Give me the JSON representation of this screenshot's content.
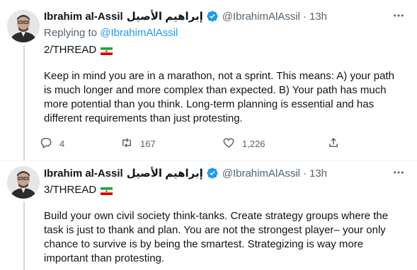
{
  "tweets": [
    {
      "author_name": "Ibrahim al-Assil",
      "author_name_arabic": "إبراهيم الأصيل",
      "handle": "@IbrahimAlAssil",
      "separator": "·",
      "time": "13h",
      "replying_prefix": "Replying to",
      "replying_handle": "@IbrahimAlAssil",
      "thread_label": "2/THREAD",
      "body": "Keep in mind you are in a marathon, not a sprint. This means: A) your path is much longer and more complex than expected. B) Your path has much more potential than you think. Long-term planning is essential and has different requirements than just protesting.",
      "reply_count": "4",
      "retweet_count": "167",
      "like_count": "1,226"
    },
    {
      "author_name": "Ibrahim al-Assil",
      "author_name_arabic": "إبراهيم الأصيل",
      "handle": "@IbrahimAlAssil",
      "separator": "·",
      "time": "13h",
      "thread_label": "3/THREAD",
      "body": "Build your own civil society think-tanks. Create strategy groups where the task is just to thank and plan. You are not the strongest player– your only chance to survive is by being the smartest. Strategizing is way more important than protesting."
    }
  ],
  "icons": {
    "verified": "verified-badge-icon",
    "more": "more-options-icon",
    "reply": "reply-icon",
    "retweet": "retweet-icon",
    "like": "heart-icon",
    "share": "share-icon",
    "flag": "iran-flag-emoji"
  },
  "colors": {
    "accent": "#1d9bf0",
    "secondary_text": "#536471",
    "primary_text": "#0f1419",
    "thread_line": "#cfd9de"
  }
}
